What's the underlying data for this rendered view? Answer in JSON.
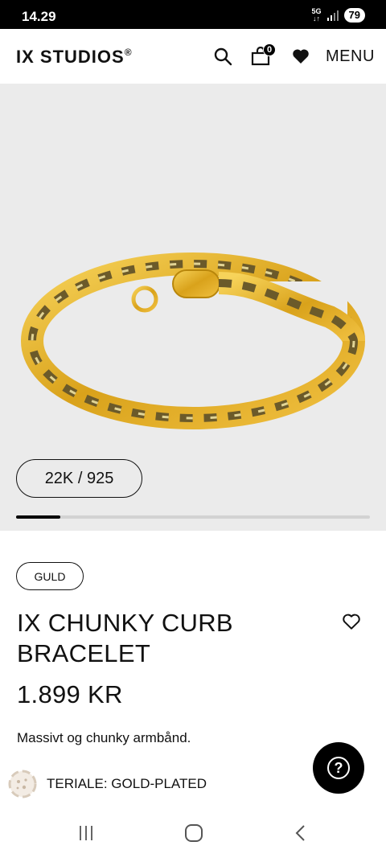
{
  "status_bar": {
    "time": "14.29",
    "network": "5G",
    "network_sub": "↓↑",
    "battery": "79"
  },
  "header": {
    "logo": "IX STUDIOS",
    "logo_mark": "®",
    "cart_count": "0",
    "menu_label": "MENU",
    "icons": [
      "search-icon",
      "shopping-bag-icon",
      "heart-icon"
    ]
  },
  "gallery": {
    "variant_label": "22K / 925",
    "image_progress": 0.125,
    "accent_gold": "#d9a21b"
  },
  "product": {
    "tag": "GULD",
    "title": "IX CHUNKY CURB BRACELET",
    "price": "1.899 KR",
    "description": "Massivt og chunky armbånd.",
    "material": "TERIALE: GOLD-PLATED"
  },
  "widgets": {
    "help_label": "?",
    "icons": [
      "cookie-icon",
      "help-icon"
    ]
  },
  "nav_bar": {
    "icons": [
      "recent-apps-icon",
      "home-icon",
      "back-icon"
    ]
  }
}
